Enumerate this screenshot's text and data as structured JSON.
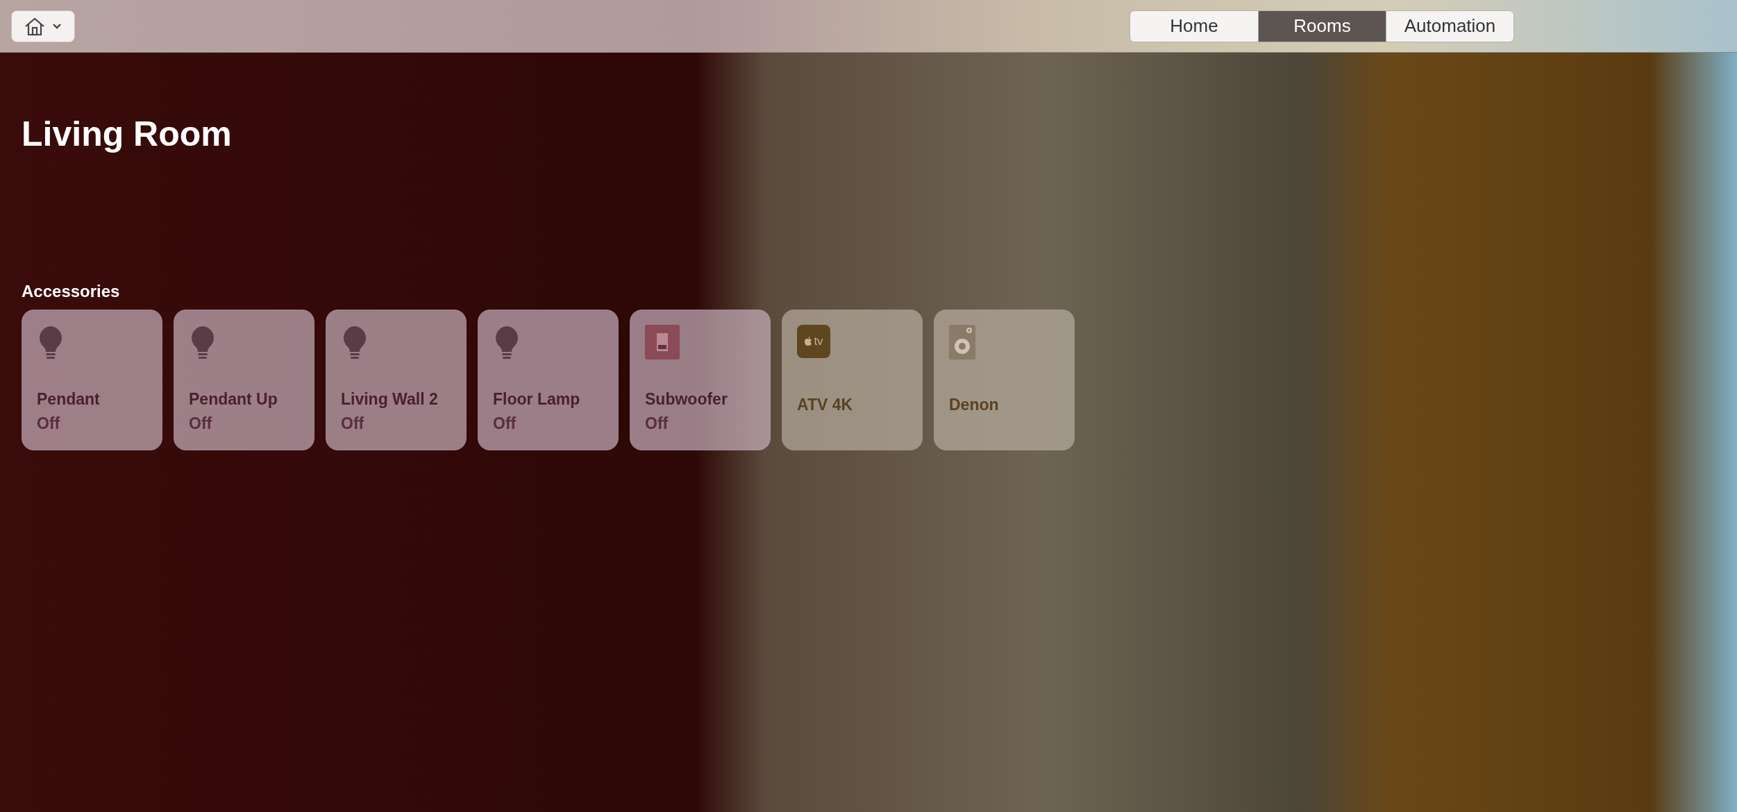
{
  "toolbar": {
    "tabs": [
      {
        "label": "Home",
        "selected": false
      },
      {
        "label": "Rooms",
        "selected": true
      },
      {
        "label": "Automation",
        "selected": false
      }
    ]
  },
  "room": {
    "title": "Living Room"
  },
  "accessories": {
    "heading": "Accessories",
    "items": [
      {
        "kind": "bulb",
        "name": "Pendant",
        "status": "Off"
      },
      {
        "kind": "bulb",
        "name": "Pendant Up",
        "status": "Off"
      },
      {
        "kind": "bulb",
        "name": "Living Wall 2",
        "status": "Off"
      },
      {
        "kind": "bulb",
        "name": "Floor Lamp",
        "status": "Off"
      },
      {
        "kind": "switch",
        "name": "Subwoofer",
        "status": "Off"
      },
      {
        "kind": "tv",
        "name": "ATV 4K",
        "icon_text": "tv"
      },
      {
        "kind": "speaker",
        "name": "Denon"
      }
    ]
  }
}
